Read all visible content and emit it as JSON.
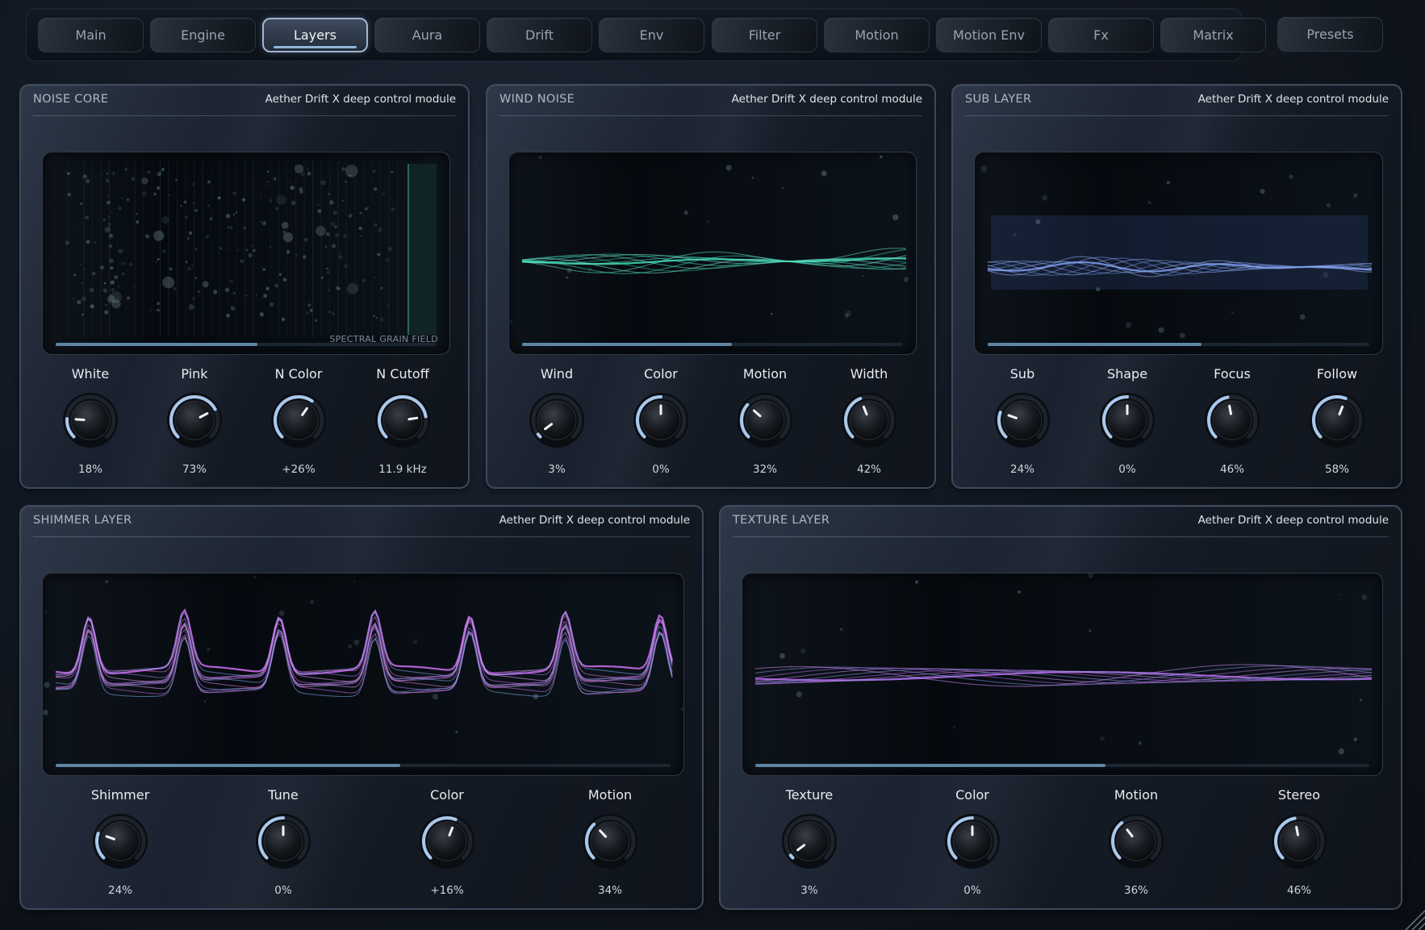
{
  "tabs": [
    {
      "label": "Main"
    },
    {
      "label": "Engine"
    },
    {
      "label": "Layers",
      "active": true
    },
    {
      "label": "Aura"
    },
    {
      "label": "Drift"
    },
    {
      "label": "Env"
    },
    {
      "label": "Filter"
    },
    {
      "label": "Motion"
    },
    {
      "label": "Motion Env"
    },
    {
      "label": "Fx"
    },
    {
      "label": "Matrix"
    },
    {
      "label": "Presets"
    }
  ],
  "panels": {
    "noise_core": {
      "title": "NOISE CORE",
      "subtitle": "Aether Drift X deep control module",
      "visual_label": "SPECTRAL GRAIN FIELD",
      "progress": 0.53,
      "knobs": [
        {
          "label": "White",
          "value": "18%",
          "level": 0.18
        },
        {
          "label": "Pink",
          "value": "73%",
          "level": 0.73
        },
        {
          "label": "N Color",
          "value": "+26%",
          "level": 0.63
        },
        {
          "label": "N Cutoff",
          "value": "11.9 kHz",
          "level": 0.8
        }
      ]
    },
    "wind_noise": {
      "title": "WIND NOISE",
      "subtitle": "Aether Drift X deep control module",
      "progress": 0.55,
      "knobs": [
        {
          "label": "Wind",
          "value": "3%",
          "level": 0.03
        },
        {
          "label": "Color",
          "value": "0%",
          "level": 0.5
        },
        {
          "label": "Motion",
          "value": "32%",
          "level": 0.32
        },
        {
          "label": "Width",
          "value": "42%",
          "level": 0.42
        }
      ]
    },
    "sub_layer": {
      "title": "SUB LAYER",
      "subtitle": "Aether Drift X deep control module",
      "progress": 0.56,
      "knobs": [
        {
          "label": "Sub",
          "value": "24%",
          "level": 0.24
        },
        {
          "label": "Shape",
          "value": "0%",
          "level": 0.5
        },
        {
          "label": "Focus",
          "value": "46%",
          "level": 0.46
        },
        {
          "label": "Follow",
          "value": "58%",
          "level": 0.58
        }
      ]
    },
    "shimmer_layer": {
      "title": "SHIMMER LAYER",
      "subtitle": "Aether Drift X deep control module",
      "progress": 0.56,
      "knobs": [
        {
          "label": "Shimmer",
          "value": "24%",
          "level": 0.24
        },
        {
          "label": "Tune",
          "value": "0%",
          "level": 0.5
        },
        {
          "label": "Color",
          "value": "+16%",
          "level": 0.58
        },
        {
          "label": "Motion",
          "value": "34%",
          "level": 0.34
        }
      ]
    },
    "texture_layer": {
      "title": "TEXTURE LAYER",
      "subtitle": "Aether Drift X deep control module",
      "progress": 0.57,
      "knobs": [
        {
          "label": "Texture",
          "value": "3%",
          "level": 0.03
        },
        {
          "label": "Color",
          "value": "0%",
          "level": 0.5
        },
        {
          "label": "Motion",
          "value": "36%",
          "level": 0.36
        },
        {
          "label": "Stereo",
          "value": "46%",
          "level": 0.46
        }
      ]
    }
  },
  "colors": {
    "accent": "#8fb4d8",
    "teal": "#3fd4b4",
    "blue": "#7a9ae8",
    "magenta": "#c46ae8"
  }
}
